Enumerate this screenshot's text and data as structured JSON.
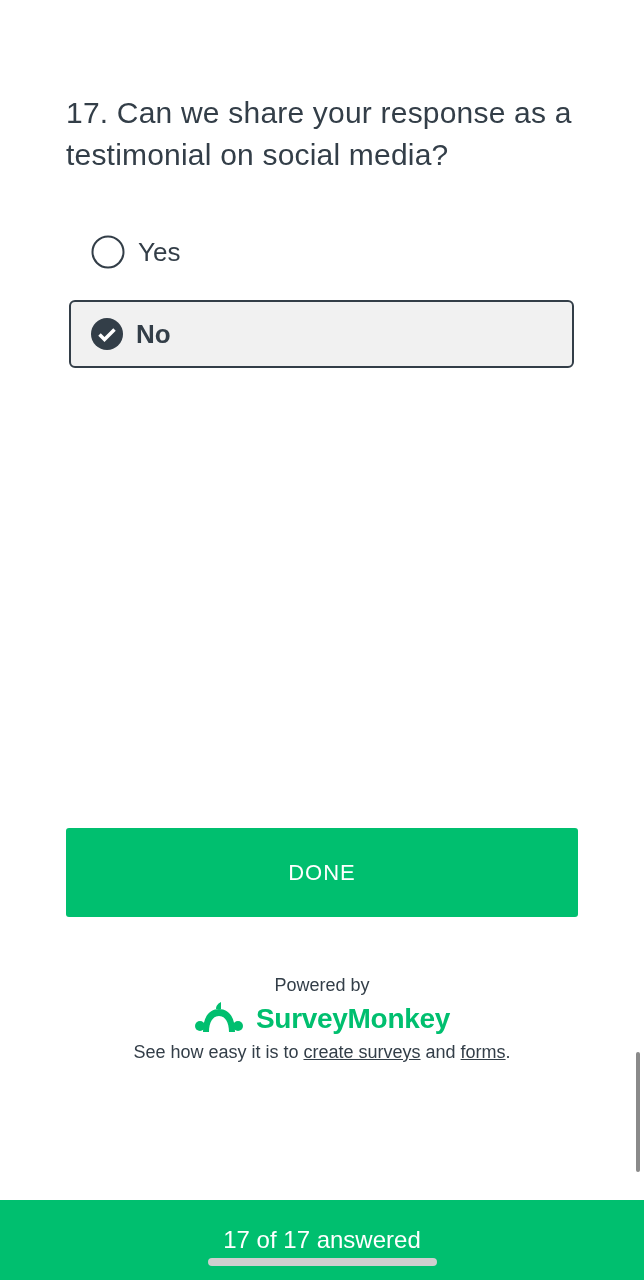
{
  "question": {
    "title": "17. Can we share your response as a testimonial on social media?",
    "options": [
      {
        "label": "Yes",
        "selected": false
      },
      {
        "label": "No",
        "selected": true
      }
    ]
  },
  "done_button": "DONE",
  "footer": {
    "powered_by": "Powered by",
    "brand": "SurveyMonkey",
    "sentence": [
      "See how easy it is to ",
      "create surveys",
      " and ",
      "forms",
      "."
    ]
  },
  "progress": {
    "label": "17 of 17 answered"
  }
}
